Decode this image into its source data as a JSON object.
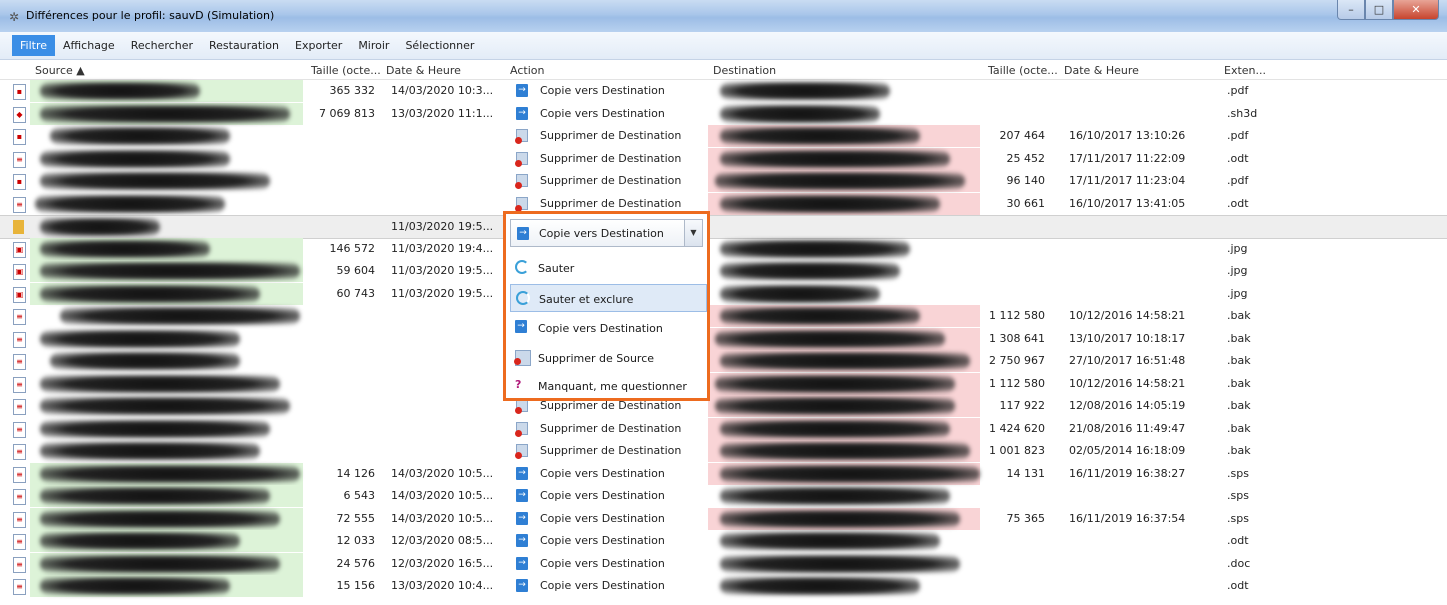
{
  "window": {
    "title": "Différences pour le profil: sauvD (Simulation)",
    "min": "–",
    "max": "□",
    "close": "✕"
  },
  "menu": [
    "Filtre",
    "Affichage",
    "Rechercher",
    "Restauration",
    "Exporter",
    "Miroir",
    "Sélectionner"
  ],
  "columns": {
    "source": "Source ▲",
    "size": "Taille (octe...",
    "date": "Date & Heure",
    "action": "Action",
    "destination": "Destination",
    "dest_size": "Taille (octe...",
    "dest_date": "Date & Heure",
    "ext": "Exten..."
  },
  "rows": [
    {
      "size": "365 332",
      "date": "14/03/2020 10:3...",
      "action": "Copie vers Destination",
      "dsize": "",
      "ddate": "",
      "ext": ".pdf"
    },
    {
      "size": "7 069 813",
      "date": "13/03/2020 11:1...",
      "action": "Copie vers Destination",
      "dsize": "",
      "ddate": "",
      "ext": ".sh3d"
    },
    {
      "size": "",
      "date": "",
      "action": "Supprimer de Destination",
      "dsize": "207 464",
      "ddate": "16/10/2017 13:10:26",
      "ext": ".pdf"
    },
    {
      "size": "",
      "date": "",
      "action": "Supprimer de Destination",
      "dsize": "25 452",
      "ddate": "17/11/2017 11:22:09",
      "ext": ".odt"
    },
    {
      "size": "",
      "date": "",
      "action": "Supprimer de Destination",
      "dsize": "96 140",
      "ddate": "17/11/2017 11:23:04",
      "ext": ".pdf"
    },
    {
      "size": "",
      "date": "",
      "action": "Supprimer de Destination",
      "dsize": "30 661",
      "ddate": "16/10/2017 13:41:05",
      "ext": ".odt"
    },
    {
      "size": "",
      "date": "11/03/2020 19:5...",
      "action": "",
      "dsize": "",
      "ddate": "",
      "ext": ""
    },
    {
      "size": "146 572",
      "date": "11/03/2020 19:4...",
      "action": "",
      "dsize": "",
      "ddate": "",
      "ext": ".jpg"
    },
    {
      "size": "59 604",
      "date": "11/03/2020 19:5...",
      "action": "",
      "dsize": "",
      "ddate": "",
      "ext": ".jpg"
    },
    {
      "size": "60 743",
      "date": "11/03/2020 19:5...",
      "action": "",
      "dsize": "",
      "ddate": "",
      "ext": ".jpg"
    },
    {
      "size": "",
      "date": "",
      "action": "",
      "dsize": "1 112 580",
      "ddate": "10/12/2016 14:58:21",
      "ext": ".bak"
    },
    {
      "size": "",
      "date": "",
      "action": "",
      "dsize": "1 308 641",
      "ddate": "13/10/2017 10:18:17",
      "ext": ".bak"
    },
    {
      "size": "",
      "date": "",
      "action": "",
      "dsize": "2 750 967",
      "ddate": "27/10/2017 16:51:48",
      "ext": ".bak"
    },
    {
      "size": "",
      "date": "",
      "action": "",
      "dsize": "1 112 580",
      "ddate": "10/12/2016 14:58:21",
      "ext": ".bak"
    },
    {
      "size": "",
      "date": "",
      "action": "Supprimer de Destination",
      "dsize": "117 922",
      "ddate": "12/08/2016 14:05:19",
      "ext": ".bak"
    },
    {
      "size": "",
      "date": "",
      "action": "Supprimer de Destination",
      "dsize": "1 424 620",
      "ddate": "21/08/2016 11:49:47",
      "ext": ".bak"
    },
    {
      "size": "",
      "date": "",
      "action": "Supprimer de Destination",
      "dsize": "1 001 823",
      "ddate": "02/05/2014 16:18:09",
      "ext": ".bak"
    },
    {
      "size": "14 126",
      "date": "14/03/2020 10:5...",
      "action": "Copie vers Destination",
      "dsize": "14 131",
      "ddate": "16/11/2019 16:38:27",
      "ext": ".sps"
    },
    {
      "size": "6 543",
      "date": "14/03/2020 10:5...",
      "action": "Copie vers Destination",
      "dsize": "",
      "ddate": "",
      "ext": ".sps"
    },
    {
      "size": "72 555",
      "date": "14/03/2020 10:5...",
      "action": "Copie vers Destination",
      "dsize": "75 365",
      "ddate": "16/11/2019 16:37:54",
      "ext": ".sps"
    },
    {
      "size": "12 033",
      "date": "12/03/2020 08:5...",
      "action": "Copie vers Destination",
      "dsize": "",
      "ddate": "",
      "ext": ".odt"
    },
    {
      "size": "24 576",
      "date": "12/03/2020 16:5...",
      "action": "Copie vers Destination",
      "dsize": "",
      "ddate": "",
      "ext": ".doc"
    },
    {
      "size": "15 156",
      "date": "13/03/2020 10:4...",
      "action": "Copie vers Destination",
      "dsize": "",
      "ddate": "",
      "ext": ".odt"
    }
  ],
  "dropdown": {
    "selected": "Copie vers Destination",
    "options": [
      "Sauter",
      "Sauter et exclure",
      "Copie vers Destination",
      "Supprimer de Source",
      "Manquant, me questionner"
    ]
  },
  "colors": {
    "accent": "#3b8ee6",
    "highlight_border": "#ed6b1f",
    "source_new": "#ddf3d8",
    "dest_only": "#f9d4d6"
  }
}
